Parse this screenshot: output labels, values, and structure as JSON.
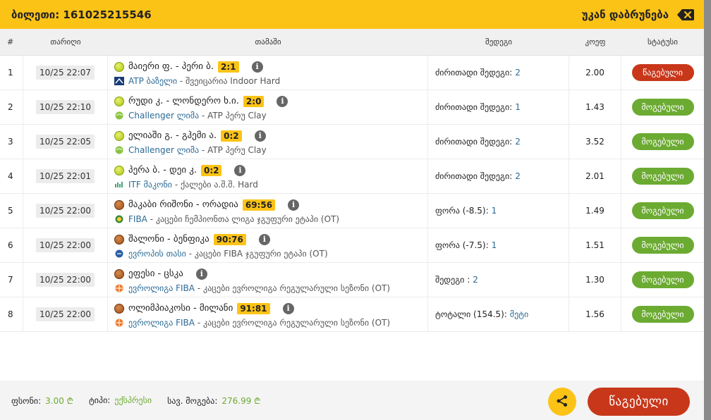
{
  "header": {
    "ticket_label": "ბილეთი: 161025215546",
    "back_label": "უკან დაბრუნება"
  },
  "table": {
    "columns": [
      "#",
      "თარიღი",
      "თამაში",
      "შედეგი",
      "კოეფ",
      "სტატუსი"
    ],
    "rows": [
      {
        "num": "1",
        "date": "10/25 22:07",
        "sport": "tennis",
        "teams": "მაიერი ფ. - პერი ბ.",
        "score": "2:1",
        "league": "ATP ბაზელი",
        "league_rest": "- შვეიცარია Indoor Hard",
        "result_label": "ძირითადი შედეგი:",
        "result_val": "2",
        "coef": "2.00",
        "status": "წაგებული",
        "status_type": "lost"
      },
      {
        "num": "2",
        "date": "10/25 22:10",
        "sport": "tennis",
        "teams": "რუდი კ. - ლონდერო ხ.ი.",
        "score": "2:0",
        "league": "Challenger ლიმა",
        "league_rest": "- ATP პერუ Clay",
        "result_label": "ძირითადი შედეგი:",
        "result_val": "1",
        "coef": "1.43",
        "status": "მოგებული",
        "status_type": "won"
      },
      {
        "num": "3",
        "date": "10/25 22:05",
        "sport": "tennis",
        "teams": "ელიაში გ. - გჰემი ა.",
        "score": "0:2",
        "league": "Challenger ლიმა",
        "league_rest": "- ATP პერუ Clay",
        "result_label": "ძირითადი შედეგი:",
        "result_val": "2",
        "coef": "3.52",
        "status": "მოგებული",
        "status_type": "won"
      },
      {
        "num": "4",
        "date": "10/25 22:01",
        "sport": "tennis",
        "teams": "პერა ბ. - დეი კ.",
        "score": "0:2",
        "league": "ITF მაკონი",
        "league_rest": "- ქალები ა.შ.შ. Hard",
        "result_label": "ძირითადი შედეგი:",
        "result_val": "2",
        "coef": "2.01",
        "status": "მოგებული",
        "status_type": "won"
      },
      {
        "num": "5",
        "date": "10/25 22:00",
        "sport": "basket",
        "teams": "მაკაბი რიშონი - ორადია",
        "score": "69:56",
        "league": "FIBA",
        "league_rest": "- კაცები ჩემპიონთა ლიგა ჯგუფური ეტაპი (OT)",
        "result_label": "ფორა (-8.5):",
        "result_val": "1",
        "coef": "1.49",
        "status": "მოგებული",
        "status_type": "won"
      },
      {
        "num": "6",
        "date": "10/25 22:00",
        "sport": "basket",
        "teams": "შალონი - ბენფიკა",
        "score": "90:76",
        "league": "ევროპის თასი",
        "league_rest": "- კაცები FIBA ჯგუფური ეტაპი (OT)",
        "result_label": "ფორა (-7.5):",
        "result_val": "1",
        "coef": "1.51",
        "status": "მოგებული",
        "status_type": "won"
      },
      {
        "num": "7",
        "date": "10/25 22:00",
        "sport": "basket",
        "teams": "ეფესი - ცსკა",
        "score": "",
        "league": "ევროლიგა FIBA",
        "league_rest": "- კაცები ევროლიგა რეგულარული სეზონი (OT)",
        "result_label": "შედეგი :",
        "result_val": "2",
        "coef": "1.30",
        "status": "მოგებული",
        "status_type": "won"
      },
      {
        "num": "8",
        "date": "10/25 22:00",
        "sport": "basket",
        "teams": "ოლიმპიაკოსი - მილანი",
        "score": "91:81",
        "league": "ევროლიგა FIBA",
        "league_rest": "- კაცები ევროლიგა რეგულარული სეზონი (OT)",
        "result_label": "ტოტალი (154.5):",
        "result_val": "მეტი",
        "coef": "1.56",
        "status": "მოგებული",
        "status_type": "won"
      }
    ]
  },
  "footer": {
    "stake_label": "ფსონი:",
    "stake_val": "3.00 ₾",
    "type_label": "ტიპი:",
    "type_val": "ექსპრესი",
    "win_label": "სავ. მოგება:",
    "win_val": "276.99 ₾",
    "main_button": "წაგებული"
  },
  "icons": {
    "back": "backspace-icon",
    "share": "share-icon",
    "info": "info-icon"
  },
  "colors": {
    "accent": "#fcc317",
    "lost": "#c8371a",
    "won": "#6cab32",
    "link": "#2a6a96"
  }
}
